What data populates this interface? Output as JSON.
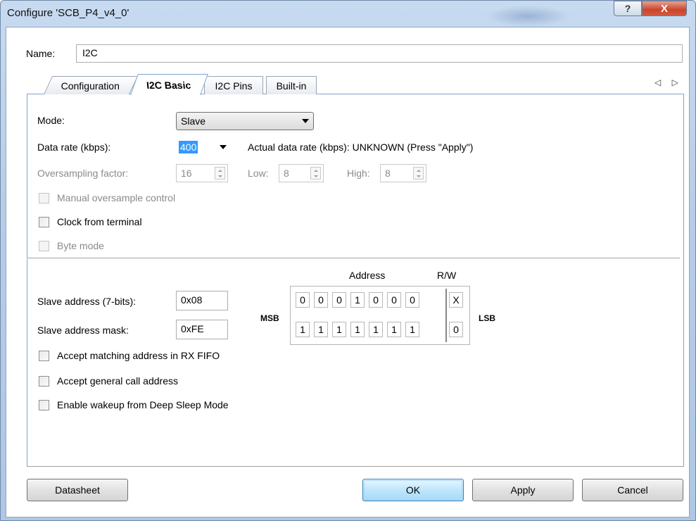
{
  "window": {
    "title": "Configure 'SCB_P4_v4_0'",
    "help_glyph": "?",
    "close_glyph": "X"
  },
  "name_row": {
    "label": "Name:",
    "value": "I2C"
  },
  "tabs": [
    {
      "label": "Configuration"
    },
    {
      "label": "I2C Basic"
    },
    {
      "label": "I2C Pins"
    },
    {
      "label": "Built-in"
    }
  ],
  "tab_nav": "◁ ▷",
  "basic": {
    "mode_label": "Mode:",
    "mode_value": "Slave",
    "data_rate_label": "Data rate (kbps):",
    "data_rate_value": "400",
    "actual_rate_text": "Actual data rate (kbps): UNKNOWN (Press \"Apply\")",
    "oversampling_label": "Oversampling factor:",
    "oversampling_value": "16",
    "low_label": "Low:",
    "low_value": "8",
    "high_label": "High:",
    "high_value": "8",
    "manual_oversample_label": "Manual oversample control",
    "clock_from_terminal_label": "Clock from terminal",
    "byte_mode_label": "Byte mode"
  },
  "address": {
    "address_header": "Address",
    "rw_header": "R/W",
    "slave_address_label": "Slave address (7-bits):",
    "slave_address_value": "0x08",
    "slave_mask_label": "Slave address mask:",
    "slave_mask_value": "0xFE",
    "msb_label": "MSB",
    "lsb_label": "LSB",
    "address_bits": [
      "0",
      "0",
      "0",
      "1",
      "0",
      "0",
      "0",
      "X"
    ],
    "mask_bits": [
      "1",
      "1",
      "1",
      "1",
      "1",
      "1",
      "1",
      "0"
    ],
    "accept_matching_label": "Accept matching address in RX FIFO",
    "accept_general_call_label": "Accept general call address",
    "enable_wakeup_label": "Enable wakeup from Deep Sleep Mode"
  },
  "buttons": {
    "datasheet": "Datasheet",
    "ok": "OK",
    "apply": "Apply",
    "cancel": "Cancel"
  },
  "colors": {
    "accent": "#3399ff",
    "tab_border": "#7ea3cf",
    "close_button": "#c8452e"
  }
}
